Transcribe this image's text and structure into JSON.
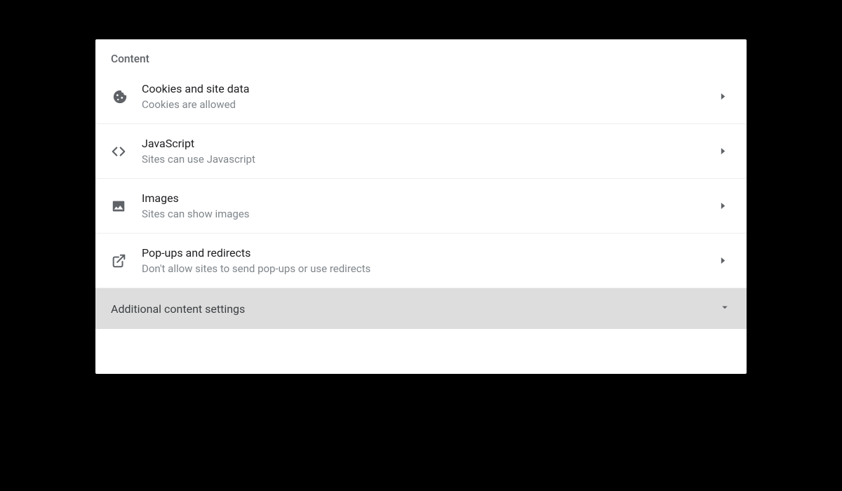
{
  "section": {
    "title": "Content"
  },
  "items": [
    {
      "icon": "cookie-icon",
      "title": "Cookies and site data",
      "sub": "Cookies are allowed"
    },
    {
      "icon": "code-icon",
      "title": "JavaScript",
      "sub": "Sites can use Javascript"
    },
    {
      "icon": "image-icon",
      "title": "Images",
      "sub": "Sites can show images"
    },
    {
      "icon": "launch-icon",
      "title": "Pop-ups and redirects",
      "sub": "Don't allow sites to send pop-ups or use redirects"
    }
  ],
  "expand": {
    "label": "Additional content settings"
  }
}
